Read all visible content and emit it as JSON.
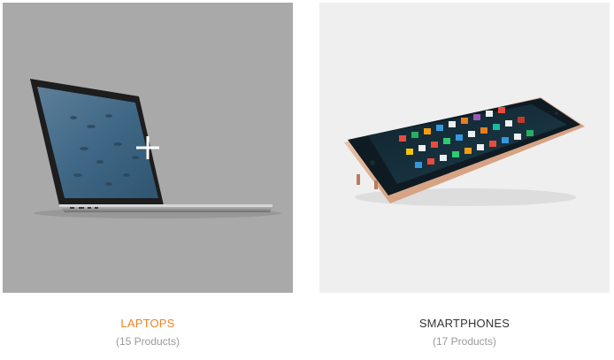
{
  "categories": [
    {
      "title": "LAPTOPS",
      "count": "(15 Products)",
      "title_color": "#e8842c",
      "image": "laptop-image",
      "overlay_icon": "plus-icon"
    },
    {
      "title": "SMARTPHONES",
      "count": "(17 Products)",
      "title_color": "#333333",
      "image": "smartphone-image"
    }
  ]
}
